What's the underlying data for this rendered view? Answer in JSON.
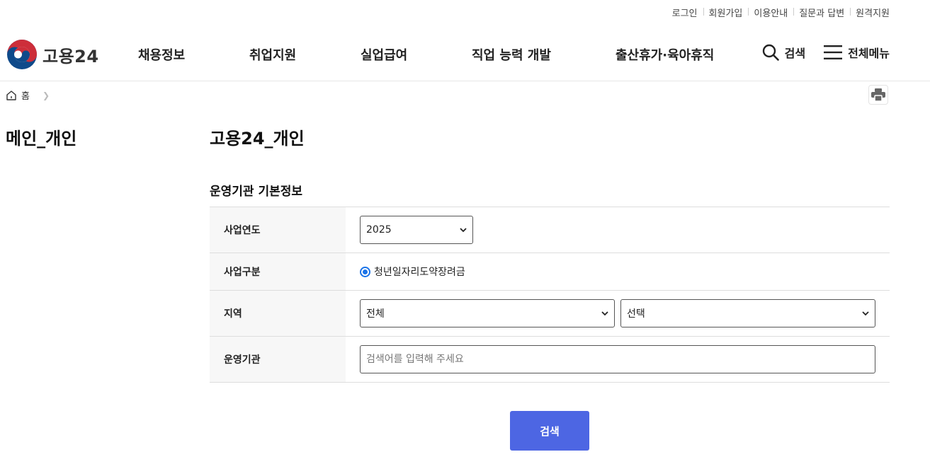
{
  "utility_links": [
    "로그인",
    "회원가입",
    "이용안내",
    "질문과 답변",
    "원격지원"
  ],
  "logo": {
    "text": "고용24"
  },
  "gnb": [
    "채용정보",
    "취업지원",
    "실업급여",
    "직업 능력 개발",
    "출산휴가·육아휴직"
  ],
  "tools": {
    "search_label": "검색",
    "menu_label": "전체메뉴"
  },
  "breadcrumb": {
    "home": "홈"
  },
  "side": {
    "title": "메인_개인"
  },
  "main": {
    "title": "고용24_개인",
    "section_title": "운영기관 기본정보"
  },
  "form": {
    "year_label": "사업연도",
    "year_value": "2025",
    "type_label": "사업구분",
    "type_option": "청년일자리도약장려금",
    "region_label": "지역",
    "region_value1": "전체",
    "region_value2": "선택",
    "org_label": "운영기관",
    "org_placeholder": "검색어를 입력해 주세요"
  },
  "actions": {
    "search_button": "검색"
  },
  "colors": {
    "primary_button": "#4d66e3",
    "radio_accent": "#1a73e8",
    "logo_red": "#cd2e3a",
    "logo_blue": "#0f4a8a"
  }
}
